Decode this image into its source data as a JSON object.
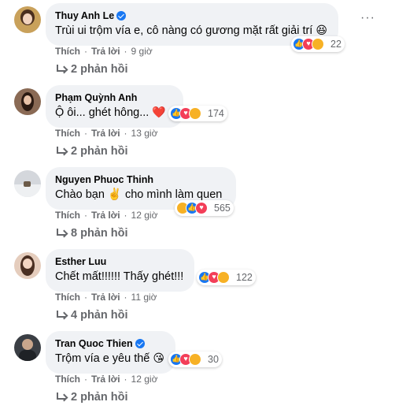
{
  "comments": [
    {
      "author": "Thuy Anh Le",
      "verified": true,
      "text": "Trùi ui trộm vía e, cô nàng có gương mặt rất giải trí",
      "emoji": "😆",
      "reaction_count": "22",
      "reactions": [
        "like-icon",
        "love-icon",
        "haha-icon"
      ],
      "like_label": "Thích",
      "reply_label": "Trả lời",
      "time": "9 giờ",
      "replies_label": "2 phản hồi",
      "avatar_color": "#c9a15b"
    },
    {
      "author": "Phạm Quỳnh Anh",
      "verified": false,
      "text": "Ộ ôi... ghét hông...",
      "emoji": "❤️",
      "reaction_count": "174",
      "reactions": [
        "like-icon",
        "love-icon",
        "care-icon"
      ],
      "like_label": "Thích",
      "reply_label": "Trả lời",
      "time": "13 giờ",
      "replies_label": "2 phản hồi",
      "avatar_color": "#8a6a55"
    },
    {
      "author": "Nguyen Phuoc Thinh",
      "verified": false,
      "text": "Chào bạn ✌️ cho mình làm quen",
      "emoji": "",
      "reaction_count": "565",
      "reactions": [
        "haha-icon",
        "like-icon",
        "love-icon"
      ],
      "like_label": "Thích",
      "reply_label": "Trả lời",
      "time": "12 giờ",
      "replies_label": "8 phản hồi",
      "avatar_color": "#b9bec6"
    },
    {
      "author": "Esther Luu",
      "verified": false,
      "text": "Chết mất!!!!!! Thấy ghét!!!",
      "emoji": "",
      "reaction_count": "122",
      "reactions": [
        "like-icon",
        "love-icon",
        "care-icon"
      ],
      "like_label": "Thích",
      "reply_label": "Trả lời",
      "time": "11 giờ",
      "replies_label": "4 phản hồi",
      "avatar_color": "#d8b4a0"
    },
    {
      "author": "Tran Quoc Thien",
      "verified": true,
      "text": "Trộm vía e yêu thế",
      "emoji": "😘",
      "reaction_count": "30",
      "reactions": [
        "like-icon",
        "love-icon",
        "care-icon"
      ],
      "like_label": "Thích",
      "reply_label": "Trả lời",
      "time": "12 giờ",
      "replies_label": "2 phản hồi",
      "avatar_color": "#3a3e44"
    }
  ]
}
